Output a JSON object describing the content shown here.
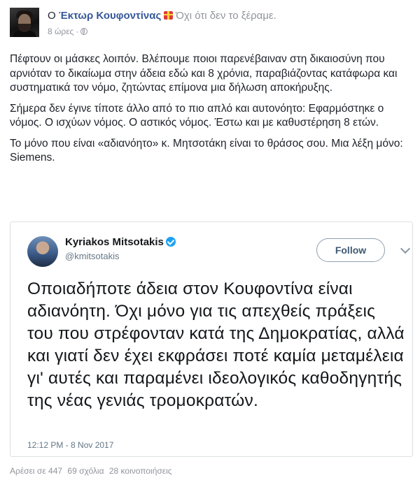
{
  "post": {
    "header_prefix": "Ο",
    "author": "Έκτωρ Κουφοντίνας",
    "status": "Όχι ότι δεν το ξέραμε.",
    "time": "8 ώρες",
    "paragraphs": [
      "Πέφτουν οι μάσκες λοιπόν. Βλέπουμε ποιοι παρενέβαιναν στη δικαιοσύνη που αρνιόταν το δικαίωμα στην άδεια εδώ και 8 χρόνια, παραβιάζοντας κατάφωρα και συστηματικά τον νόμο, ζητώντας επίμονα μια δήλωση αποκήρυξης.",
      "Σήμερα δεν έγινε τίποτε άλλο από το πιο απλό και αυτονόητο: Εφαρμόστηκε ο νόμος. Ο ισχύων νόμος. Ο αστικός νόμος. Έστω και με καθυστέρηση 8 ετών.",
      "Το μόνο που είναι «αδιανόητο» κ. Μητσοτάκη είναι το θράσος σου. Μια λέξη μόνο: Siemens."
    ]
  },
  "tweet": {
    "name": "Kyriakos Mitsotakis",
    "handle": "@kmitsotakis",
    "follow_label": "Follow",
    "text": "Οποιαδήποτε άδεια στον Κουφοντίνα είναι αδιανόητη. Όχι μόνο για τις απεχθείς πράξεις του που στρέφονταν κατά της Δημοκρατίας, αλλά και γιατί δεν έχει εκφράσει ποτέ καμία μεταμέλεια γι' αυτές και παραμένει ιδεολογικός καθοδηγητής της νέας γενιάς τρομοκρατών.",
    "timestamp": "12:12 PM - 8 Nov 2017",
    "verified_color": "#1da1f2"
  },
  "stats": {
    "likes": "Αρέσει σε 447",
    "comments": "69 σχόλια",
    "shares": "28 κοινοποιήσεις"
  },
  "icons": {
    "privacy": "globe-icon",
    "verified": "verified-badge-icon",
    "menu": "chevron-down-icon",
    "feeling": "gift-icon"
  },
  "colors": {
    "link": "#365899",
    "muted": "#90949c",
    "text": "#1d2129"
  }
}
